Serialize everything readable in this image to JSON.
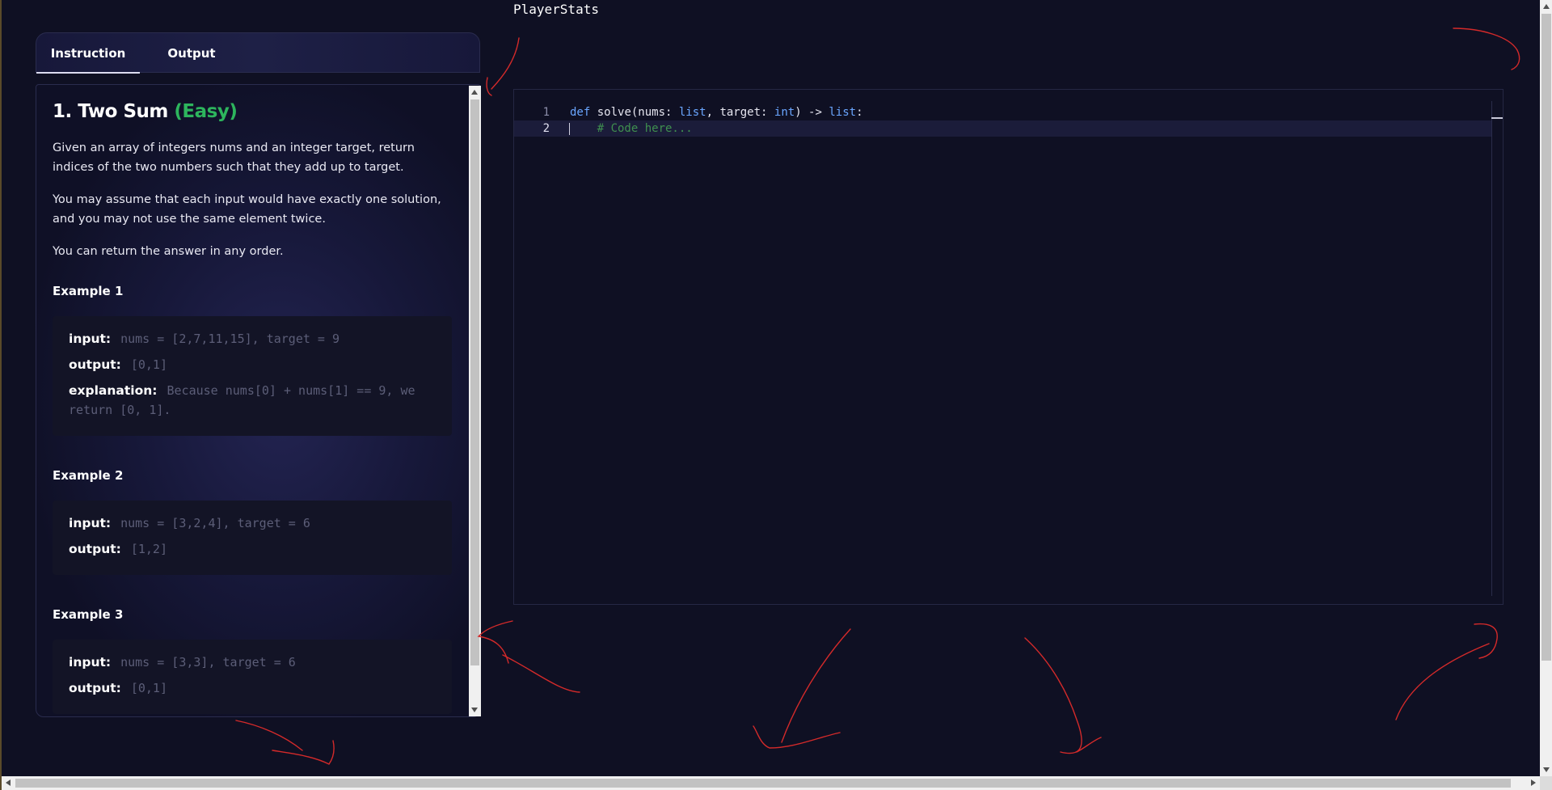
{
  "window": {
    "title": "PlayerStats"
  },
  "tabs": [
    {
      "label": "Instruction",
      "active": true
    },
    {
      "label": "Output",
      "active": false
    }
  ],
  "problem": {
    "number_title": "1. Two Sum",
    "difficulty": "(Easy)",
    "difficulty_color": "#2db55d",
    "paragraphs": [
      "Given an array of integers nums and an integer target, return indices of the two numbers such that they add up to target.",
      "You may assume that each input would have exactly one solution, and you may not use the same element twice.",
      "You can return the answer in any order."
    ],
    "examples": [
      {
        "heading": "Example 1",
        "input_label": "input:",
        "input": "nums = [2,7,11,15], target = 9",
        "output_label": "output:",
        "output": "[0,1]",
        "explanation_label": "explanation:",
        "explanation": "Because nums[0] + nums[1] == 9, we return [0, 1]."
      },
      {
        "heading": "Example 2",
        "input_label": "input:",
        "input": "nums = [3,2,4], target = 6",
        "output_label": "output:",
        "output": "[1,2]"
      },
      {
        "heading": "Example 3",
        "input_label": "input:",
        "input": "nums = [3,3], target = 6",
        "output_label": "output:",
        "output": "[0,1]"
      }
    ]
  },
  "editor": {
    "lines": [
      {
        "number": "1",
        "kw": "def",
        "name": " solve(nums: ",
        "t1": "list",
        "mid": ", target: ",
        "t2": "int",
        "arrow": ") -> ",
        "t3": "list",
        "end": ":"
      },
      {
        "number": "2",
        "comment": "    # Code here..."
      }
    ],
    "accent_color": "#6aa6ff",
    "comment_color": "#3f8f4f"
  }
}
